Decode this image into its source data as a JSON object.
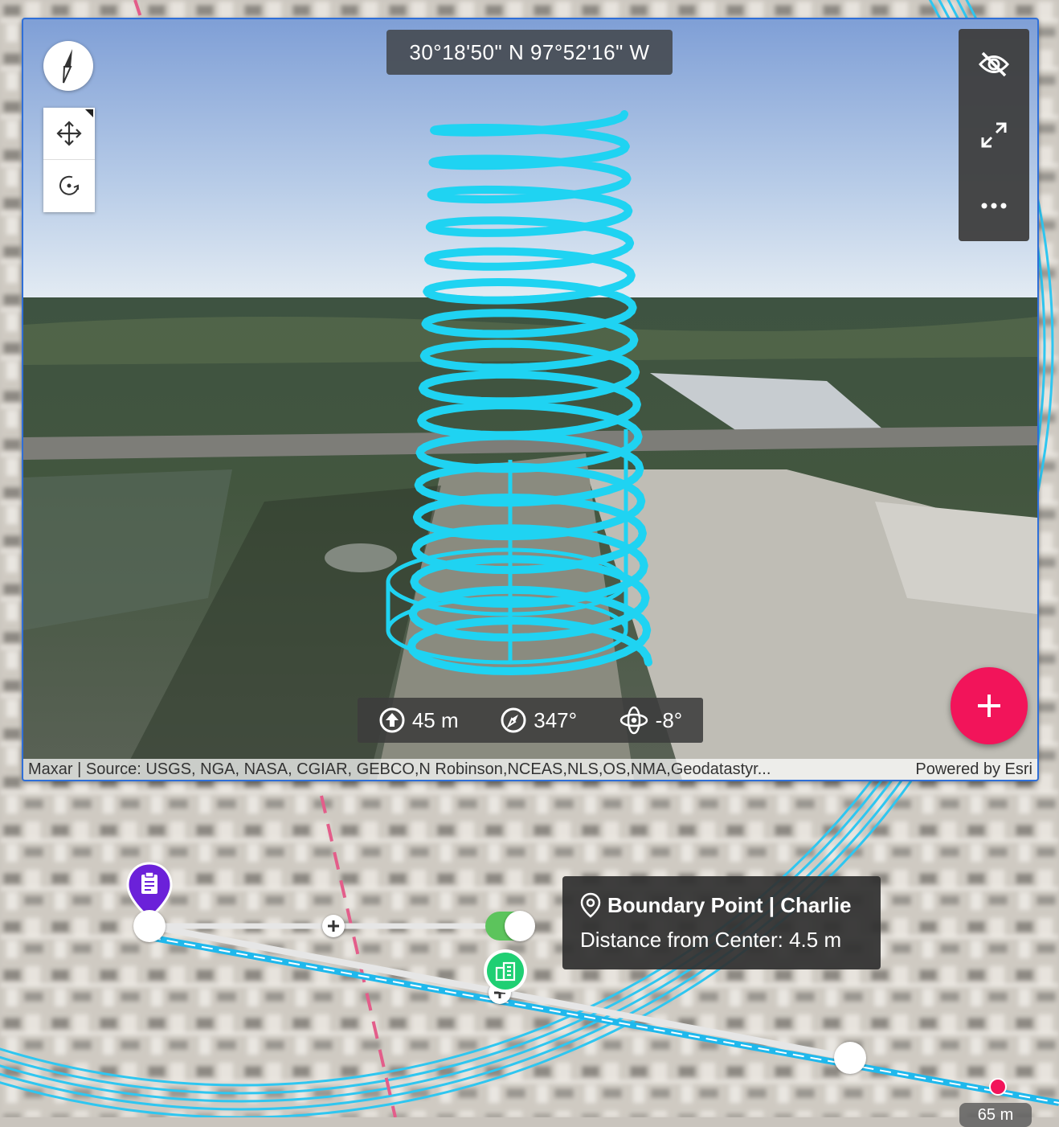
{
  "scene": {
    "coordinates": "30°18'50\" N 97°52'16\" W",
    "status": {
      "elevation": "45 m",
      "heading": "347°",
      "tilt": "-8°"
    },
    "attribution_source": "Maxar | Source: USGS, NGA, NASA, CGIAR, GEBCO,N Robinson,NCEAS,NLS,OS,NMA,Geodatastyr...",
    "attribution_powered": "Powered by Esri"
  },
  "tooltip": {
    "title": "Boundary Point | Charlie",
    "line": "Distance from Center: 4.5 m"
  },
  "scale_label": "65 m",
  "icons": {
    "compass": "compass-icon",
    "pan": "move-icon",
    "rotate": "rotate-icon",
    "hide": "eye-off-icon",
    "expand": "expand-icon",
    "more": "more-horizontal-icon",
    "elevation": "arrow-up-circle-icon",
    "heading": "compass-circle-icon",
    "tilt": "tilt-icon",
    "add": "plus-icon",
    "pin": "clipboard-pin-icon",
    "location": "location-pin-icon",
    "layer": "buildings-icon"
  },
  "colors": {
    "accent": "#f2145a",
    "helix": "#1fd3f2",
    "frame": "#2f6fd8",
    "toggle_on": "#5cc45c",
    "pin": "#6b21d9",
    "layer": "#1fcf73",
    "dashed_line": "#e35d8a"
  }
}
